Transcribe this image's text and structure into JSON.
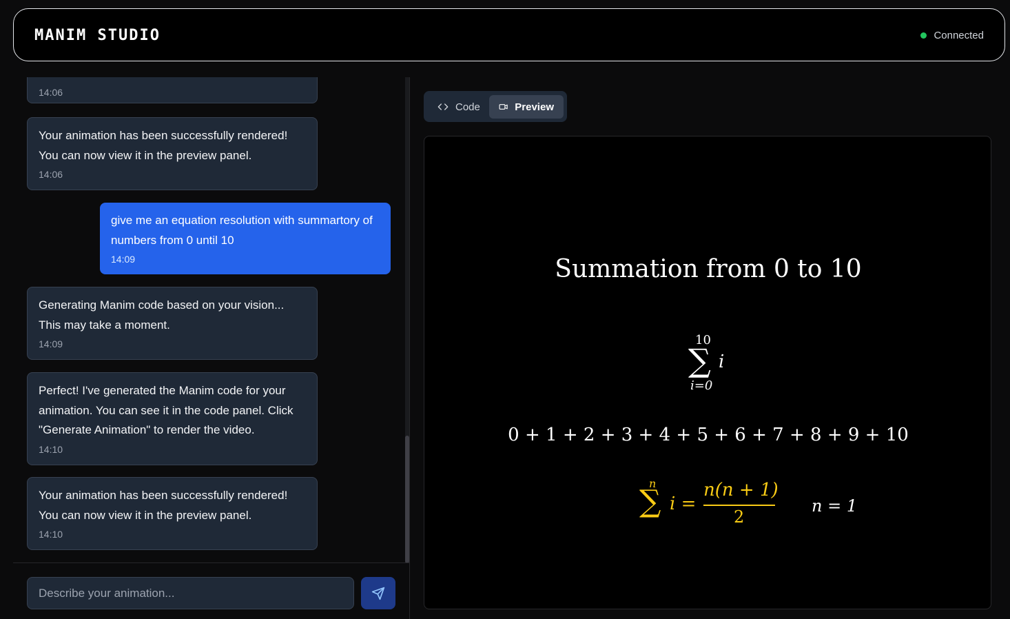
{
  "header": {
    "brand": "MANIM STUDIO",
    "status": "Connected",
    "status_color": "#22c55e"
  },
  "chat": {
    "messages": [
      {
        "role": "assistant",
        "text": "",
        "time": "14:06"
      },
      {
        "role": "assistant",
        "text": "Your animation has been successfully rendered! You can now view it in the preview panel.",
        "time": "14:06"
      },
      {
        "role": "user",
        "text": "give me an equation resolution with summartory of numbers from 0 until 10",
        "time": "14:09"
      },
      {
        "role": "assistant",
        "text": "Generating Manim code based on your vision... This may take a moment.",
        "time": "14:09"
      },
      {
        "role": "assistant",
        "text": "Perfect! I've generated the Manim code for your animation. You can see it in the code panel. Click \"Generate Animation\" to render the video.",
        "time": "14:10"
      },
      {
        "role": "assistant",
        "text": "Your animation has been successfully rendered! You can now view it in the preview panel.",
        "time": "14:10"
      }
    ],
    "input_placeholder": "Describe your animation..."
  },
  "tabs": [
    {
      "label": "Code",
      "active": false
    },
    {
      "label": "Preview",
      "active": true
    }
  ],
  "preview": {
    "title": "Summation from 0 to 10",
    "sum_upper": "10",
    "sum_lower": "i=0",
    "sum_symbol": "∑",
    "sum_var": "i",
    "expansion": "0 + 1 + 2 + 3 + 4 + 5 + 6 + 7 + 8 + 9 + 10",
    "formula_upper": "n",
    "formula_lhs": "i =",
    "formula_num": "n(n + 1)",
    "formula_den": "2",
    "n_value": "n = 1",
    "formula_color": "#facc15"
  },
  "colors": {
    "accent": "#2563eb",
    "bubble": "#1f2937",
    "send_button": "#1e3a8a"
  }
}
